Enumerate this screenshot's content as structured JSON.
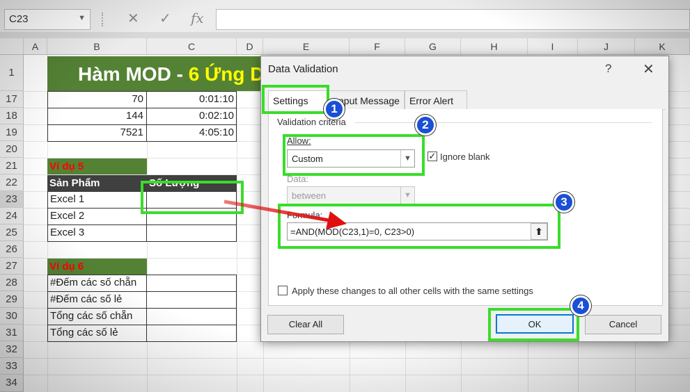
{
  "formula_bar": {
    "name_box": "C23",
    "cancel_icon": "✕",
    "enter_icon": "✓",
    "fx_label": "fx"
  },
  "columns": [
    "A",
    "B",
    "C",
    "D",
    "E",
    "F",
    "G",
    "H",
    "I",
    "J",
    "K"
  ],
  "rows": [
    "1",
    "17",
    "18",
    "19",
    "20",
    "21",
    "22",
    "23",
    "24",
    "25",
    "26",
    "27",
    "28",
    "29",
    "30",
    "31",
    "32",
    "33",
    "34"
  ],
  "sheet": {
    "title_main": "Hàm MOD - ",
    "title_accent": "6 Ứng D",
    "r17": {
      "b": "70",
      "c": "0:01:10"
    },
    "r18": {
      "b": "144",
      "c": "0:02:10"
    },
    "r19": {
      "b": "7521",
      "c": "4:05:10"
    },
    "vidu5": "Ví dụ 5",
    "header_product": "Sản Phẩm",
    "header_qty": "Số Lượng",
    "products": [
      "Excel 1",
      "Excel 2",
      "Excel 3"
    ],
    "vidu6": "Ví dụ 6",
    "vd6_items": [
      "#Đếm các số chẵn",
      "#Đếm các số lẻ",
      "Tổng các số chẵn",
      "Tổng các số lẻ"
    ]
  },
  "dialog": {
    "title": "Data Validation",
    "help": "?",
    "close": "✕",
    "tabs": [
      "Settings",
      "Input Message",
      "Error Alert"
    ],
    "tab_input_visible": "nput Message",
    "section_label": "Validation criteria",
    "allow_label": "Allow:",
    "allow_value": "Custom",
    "ignore_blank_label": "Ignore blank",
    "ignore_blank_checked": true,
    "data_label": "Data:",
    "data_value": "between",
    "formula_label": "Formula:",
    "formula_value": "=AND(MOD(C23,1)=0, C23>0)",
    "apply_all_label": "Apply these changes to all other cells with the same settings",
    "apply_all_checked": false,
    "clear_all": "Clear All",
    "ok": "OK",
    "cancel": "Cancel"
  },
  "annotations": {
    "badges": [
      "1",
      "2",
      "3",
      "4"
    ],
    "highlight_color": "#3bdc2c",
    "badge_color": "#1a4fd6",
    "arrow_color": "#e01010"
  },
  "colors": {
    "title_band": "#548235",
    "title_accent": "#ffff00",
    "example_label": "#ff0000",
    "header_band": "#404040"
  }
}
